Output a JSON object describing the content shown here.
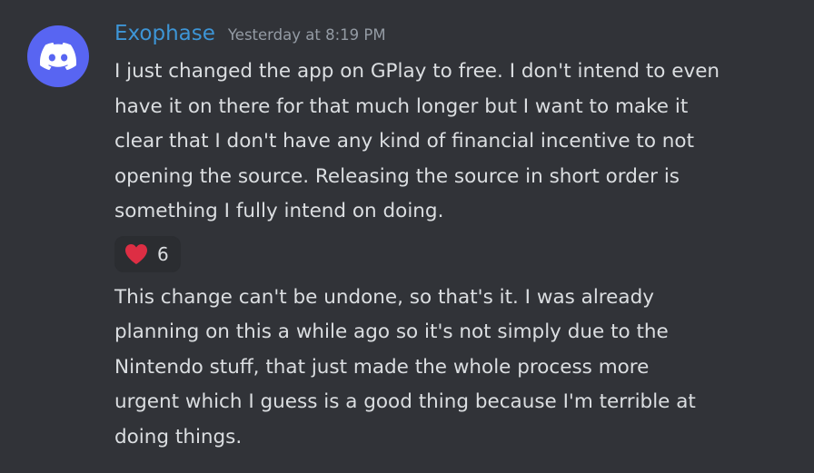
{
  "author": {
    "name": "Exophase",
    "avatar_icon": "discord-logo-icon",
    "avatar_color": "#5865f2",
    "name_color": "#3d95d6"
  },
  "timestamp": "Yesterday at 8:19 PM",
  "messages": [
    {
      "text": "I just changed the app on GPlay to free. I don't intend to even\nhave it on there for that much longer but I want to make it\nclear that I don't have any kind of financial incentive to not\nopening the source. Releasing the source in short order is\nsomething I fully intend on doing."
    },
    {
      "text": "This change can't be undone, so that's it. I was already\nplanning on this a while ago so it's not simply due to the\nNintendo stuff, that just made the whole process more\nurgent which I guess is a good thing because I'm terrible at\ndoing things."
    }
  ],
  "reaction": {
    "icon": "heart-icon",
    "color": "#dd2e44",
    "count": "6"
  }
}
